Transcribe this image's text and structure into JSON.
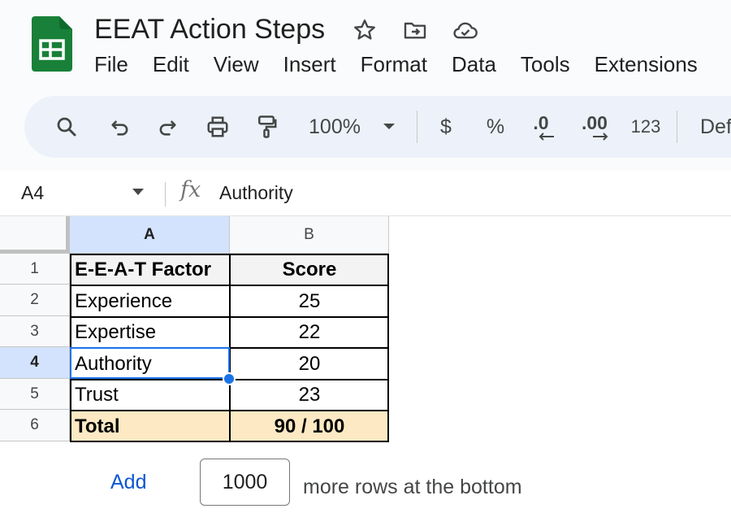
{
  "app": {
    "title": "EEAT Action Steps",
    "colors": {
      "brand_green": "#188038",
      "accent_blue": "#1a73e8",
      "toolbar_bg": "#edf2fa"
    }
  },
  "title_icons": [
    "star-icon",
    "move-to-folder-icon",
    "cloud-saved-icon"
  ],
  "menu": [
    "File",
    "Edit",
    "View",
    "Insert",
    "Format",
    "Data",
    "Tools",
    "Extensions"
  ],
  "toolbar": {
    "icons": [
      "search-icon",
      "undo-icon",
      "redo-icon",
      "print-icon",
      "paint-format-icon"
    ],
    "zoom": "100%",
    "currency": "$",
    "percent": "%",
    "decrease_decimal": ".0",
    "increase_decimal": ".00",
    "number_format": "123",
    "font_default": "Def"
  },
  "formula_bar": {
    "name_box": "A4",
    "fx": "fx",
    "value": "Authority"
  },
  "grid": {
    "columns": [
      "A",
      "B"
    ],
    "rows": [
      "1",
      "2",
      "3",
      "4",
      "5",
      "6"
    ],
    "active_cell": "A4",
    "header": [
      "E-E-A-T Factor",
      "Score"
    ],
    "data": [
      [
        "Experience",
        "25"
      ],
      [
        "Expertise",
        "22"
      ],
      [
        "Authority",
        "20"
      ],
      [
        "Trust",
        "23"
      ]
    ],
    "total": [
      "Total",
      "90 / 100"
    ],
    "header_fill": "#f3f3f3",
    "total_fill": "#fde9c4"
  },
  "add_rows": {
    "button_label": "Add",
    "count": "1000",
    "suffix": "more rows at the bottom"
  }
}
